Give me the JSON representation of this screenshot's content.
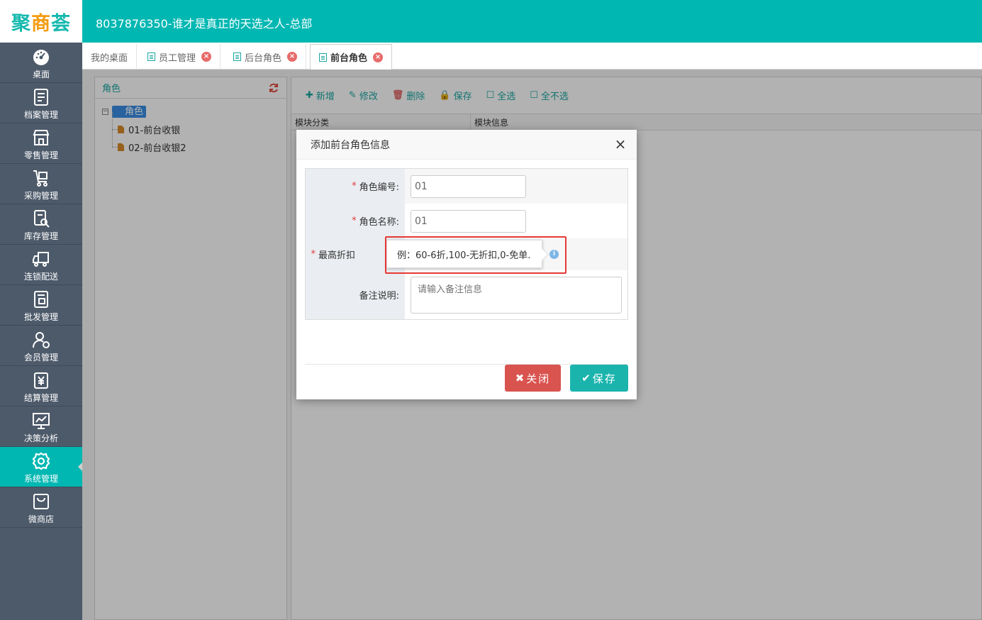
{
  "app": {
    "logo": {
      "part1": "聚",
      "part2": "商",
      "part3": "荟"
    },
    "company_title": "8037876350-谁才是真正的天选之人-总部"
  },
  "sidebar": {
    "items": [
      {
        "label": "桌面",
        "icon": "dashboard-icon"
      },
      {
        "label": "档案管理",
        "icon": "archive-icon"
      },
      {
        "label": "零售管理",
        "icon": "store-icon"
      },
      {
        "label": "采购管理",
        "icon": "cart-icon"
      },
      {
        "label": "库存管理",
        "icon": "inventory-icon"
      },
      {
        "label": "连锁配送",
        "icon": "truck-icon"
      },
      {
        "label": "批发管理",
        "icon": "wholesale-icon"
      },
      {
        "label": "会员管理",
        "icon": "member-icon"
      },
      {
        "label": "结算管理",
        "icon": "settlement-icon"
      },
      {
        "label": "决策分析",
        "icon": "analysis-icon"
      },
      {
        "label": "系统管理",
        "icon": "gear-icon",
        "active": true
      },
      {
        "label": "微商店",
        "icon": "shop-bag-icon"
      }
    ]
  },
  "tabs": [
    {
      "label": "我的桌面",
      "closable": false
    },
    {
      "label": "员工管理",
      "closable": true
    },
    {
      "label": "后台角色",
      "closable": true
    },
    {
      "label": "前台角色",
      "closable": true,
      "active": true
    }
  ],
  "left_panel": {
    "title": "角色",
    "tree": {
      "root": "角色",
      "children": [
        "01-前台收银",
        "02-前台收银2"
      ]
    }
  },
  "toolbar": {
    "add": "新增",
    "edit": "修改",
    "delete": "删除",
    "save": "保存",
    "select_all": "全选",
    "select_none": "全不选"
  },
  "grid": {
    "columns": [
      "模块分类",
      "模块信息"
    ]
  },
  "dialog": {
    "title": "添加前台角色信息",
    "fields": {
      "role_code_label": "角色编号:",
      "role_code_value": "01",
      "role_name_label": "角色名称:",
      "role_name_value": "01",
      "max_discount_label": "最高折扣",
      "remark_label": "备注说明:",
      "remark_placeholder": "请输入备注信息"
    },
    "required_mark": "*",
    "close_button": "关闭",
    "save_button": "保存"
  },
  "tooltip": {
    "text": "例：60-6折,100-无折扣,0-免单."
  },
  "colors": {
    "brand": "#00b7b2",
    "sidebar": "#4d5a6a",
    "danger": "#d9534f",
    "highlight": "#e53935"
  }
}
